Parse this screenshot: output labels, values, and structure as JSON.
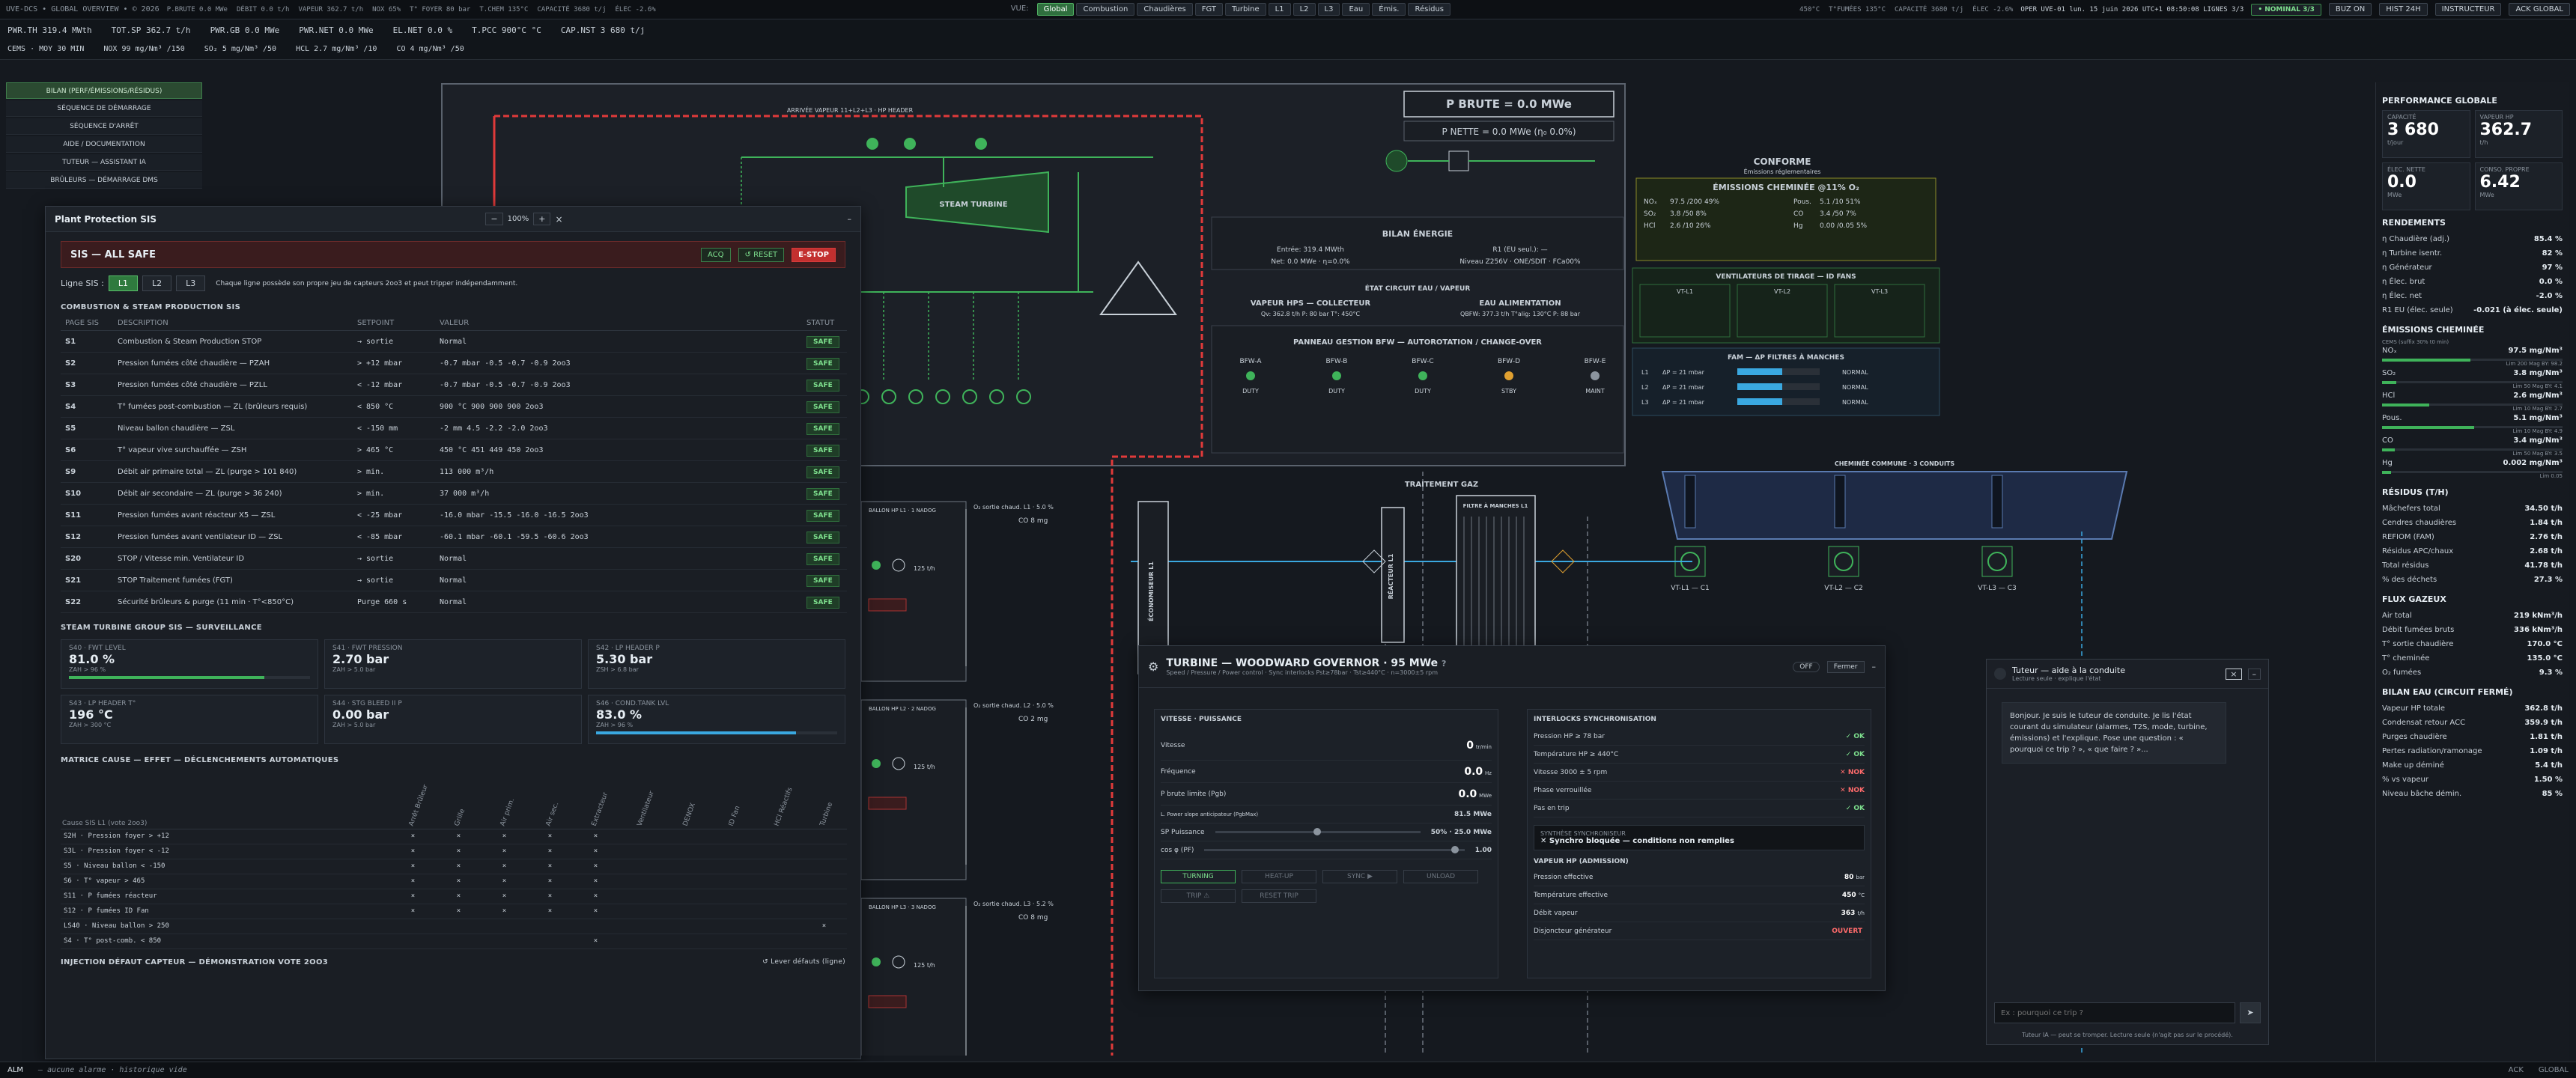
{
  "topbar": {
    "brand": "UVE-DCS • GLOBAL OVERVIEW • © 2026",
    "ticker": [
      "P.BRUTE 0.0 MWe",
      "DÉBIT 0.0 t/h",
      "VAPEUR 362.7 t/h",
      "NOX 65%",
      "T° FOYER 80 bar",
      "T.CHEM 135°C",
      "CAPACITÉ 3680 t/j",
      "ÉLEC -2.6%"
    ],
    "views_label": "VUE:",
    "views": [
      "Global",
      "Combustion",
      "Chaudières",
      "FGT",
      "Turbine",
      "L1",
      "L2",
      "L3",
      "Eau",
      "Émis.",
      "Résidus"
    ],
    "views_sub": "Global",
    "ticker_right": [
      "450°C",
      "T°FUMÉES 135°C",
      "CAPACITÉ 3680 t/j",
      "ÉLEC -2.6%"
    ],
    "status": "OPER UVE-01  lun. 15 juin 2026  UTC+1 08:50:08  LIGNES 3/3",
    "nominal": "• NOMINAL 3/3",
    "buttons": [
      "BUZ ON",
      "HIST 24H",
      "INSTRUCTEUR",
      "ACK GLOBAL"
    ]
  },
  "row2": {
    "line1": [
      "PWR.TH 319.4 MWth",
      "TOT.SP 362.7 t/h",
      "PWR.GB 0.0 MWe",
      "PWR.NET 0.0 MWe",
      "EL.NET 0.0 %",
      "T.PCC 900°C °C",
      "CAP.NST 3 680 t/j"
    ],
    "line2": [
      "CEMS · MOY 30 MIN",
      "NOX 99 mg/Nm³ /150",
      "SO₂ 5 mg/Nm³ /50",
      "HCL 2.7 mg/Nm³ /10",
      "CO 4 mg/Nm³ /50"
    ]
  },
  "nav": [
    "BILAN (PERF/ÉMISSIONS/RÉSIDUS)",
    "SÉQUENCE DE DÉMARRAGE",
    "SÉQUENCE D'ARRÊT",
    "AIDE / DOCUMENTATION",
    "TUTEUR — ASSISTANT IA",
    "BRÛLEURS — DÉMARRAGE DMS"
  ],
  "diagram": {
    "title_header": "ARRIVÉE VAPEUR 11+L2+L3 · HP HEADER",
    "p_brute": "P BRUTE = 0.0 MWe",
    "p_nette": "P NETTE = 0.0 MWe (η₀ 0.0%)",
    "steam_turbine": "STEAM TURBINE",
    "conforme": "CONFORME",
    "conforme_sub": "Émissions réglementaires",
    "emissions_title": "ÉMISSIONS CHEMINÉE @11% O₂",
    "emissions": [
      {
        "k": "NOₓ",
        "v": "97.5 /200 49%"
      },
      {
        "k": "SO₂",
        "v": "3.8 /50 8%"
      },
      {
        "k": "HCl",
        "v": "2.6 /10 26%"
      },
      {
        "k": "Pous.",
        "v": "5.1 /10 51%"
      },
      {
        "k": "CO",
        "v": "3.4 /50 7%"
      },
      {
        "k": "Hg",
        "v": "0.00 /0.05 5%"
      }
    ],
    "bilan_title": "BILAN ÉNERGIE",
    "bilan_lines": [
      "Entrée: 319.4 MWth",
      "Net: 0.0 MWe · η=0.0%",
      "R1 (EU seul.): —",
      "Niveau Z256V · ONE/SDIT · FCa00%"
    ],
    "etat_title": "ÉTAT CIRCUIT EAU / VAPEUR",
    "vapeur_title": "VAPEUR HPS — COLLECTEUR",
    "vapeur_line": "Qv: 362.8 t/h P: 80 bar T°: 450°C",
    "eau_title": "EAU ALIMENTATION",
    "eau_line": "QBFW: 377.3 t/h T°alig: 130°C P: 88 bar",
    "panneau": "PANNEAU GESTION BFW — AUTOROTATION / CHANGE-OVER",
    "pumps": [
      {
        "n": "BFW-A",
        "s": "DUTY",
        "c": "#3fb35a"
      },
      {
        "n": "BFW-B",
        "s": "DUTY",
        "c": "#3fb35a"
      },
      {
        "n": "BFW-C",
        "s": "DUTY",
        "c": "#3fb35a"
      },
      {
        "n": "BFW-D",
        "s": "STBY",
        "c": "#e0a030"
      },
      {
        "n": "BFW-E",
        "s": "MAINT",
        "c": "#8b949e"
      }
    ],
    "ventilateurs": "VENTILATEURS DE TIRAGE — ID FANS",
    "vt": [
      "VT-L1",
      "VT-L2",
      "VT-L3"
    ],
    "fam": "FAM — ΔP FILTRES À MANCHES",
    "fam_rows": [
      {
        "l": "L1",
        "v": "ΔP = 21 mbar",
        "s": "NORMAL"
      },
      {
        "l": "L2",
        "v": "ΔP = 21 mbar",
        "s": "NORMAL"
      },
      {
        "l": "L3",
        "v": "ΔP = 21 mbar",
        "s": "NORMAL"
      }
    ],
    "cheminee": "CHEMINÉE COMMUNE · 3 CONDUITS",
    "vt_bottom": [
      "VT-L1 — C1",
      "VT-L2 — C2",
      "VT-L3 — C3"
    ],
    "traitement": "TRAITEMENT GAZ",
    "filtre": "FILTRE À MANCHES L1",
    "economiseur": "ÉCONOMISEUR L1",
    "reacteur": "RÉACTEUR L1",
    "ballons": [
      "BALLON HP L1 · 1 NADOG",
      "BALLON HP L2 · 2 NADOG",
      "BALLON HP L3 · 3 NADOG"
    ],
    "o2": [
      "O₂ sortie chaud. L1 · 5.0 %",
      "O₂ sortie chaud. L2 · 5.0 %",
      "O₂ sortie chaud. L3 · 5.2 %"
    ],
    "co": [
      "CO 8 mg",
      "CO 2 mg",
      "CO 8 mg"
    ],
    "flow": [
      "125 t/h",
      "125 t/h",
      "125 t/h"
    ]
  },
  "sis": {
    "title": "Plant Protection SIS",
    "zoom": "100%",
    "status": "SIS — ALL SAFE",
    "ack": "ACQ",
    "reset": "↺ RESET",
    "estop": "E-STOP",
    "lines_label": "Ligne SIS :",
    "lines": [
      "L1",
      "L2",
      "L3"
    ],
    "lines_note": "Chaque ligne possède son propre jeu de capteurs 2oo3 et peut tripper indépendamment.",
    "sect1": "COMBUSTION & STEAM PRODUCTION SIS",
    "cols": [
      "PAGE SIS",
      "DESCRIPTION",
      "SETPOINT",
      "VALEUR",
      "STATUT"
    ],
    "rows": [
      {
        "p": "S1",
        "d": "Combustion & Steam Production STOP",
        "sp": "→ sortie",
        "v": "Normal",
        "s": "SAFE"
      },
      {
        "p": "S2",
        "d": "Pression fumées côté chaudière — PZAH",
        "sp": "> +12 mbar",
        "v": "-0.7 mbar  -0.5 -0.7 -0.9  2oo3",
        "s": "SAFE"
      },
      {
        "p": "S3",
        "d": "Pression fumées côté chaudière — PZLL",
        "sp": "< -12 mbar",
        "v": "-0.7 mbar  -0.5 -0.7 -0.9  2oo3",
        "s": "SAFE"
      },
      {
        "p": "S4",
        "d": "T° fumées post-combustion — ZL (brûleurs requis)",
        "sp": "< 850 °C",
        "v": "900 °C  900 900 900  2oo3",
        "s": "SAFE"
      },
      {
        "p": "S5",
        "d": "Niveau ballon chaudière — ZSL",
        "sp": "< -150 mm",
        "v": "-2 mm  4.5 -2.2 -2.0  2oo3",
        "s": "SAFE"
      },
      {
        "p": "S6",
        "d": "T° vapeur vive surchauffée — ZSH",
        "sp": "> 465 °C",
        "v": "450 °C  451 449 450  2oo3",
        "s": "SAFE"
      },
      {
        "p": "S9",
        "d": "Débit air primaire total — ZL (purge > 101 840)",
        "sp": "> min.",
        "v": "113 000 m³/h",
        "s": "SAFE"
      },
      {
        "p": "S10",
        "d": "Débit air secondaire — ZL (purge > 36 240)",
        "sp": "> min.",
        "v": "37 000 m³/h",
        "s": "SAFE"
      },
      {
        "p": "S11",
        "d": "Pression fumées avant réacteur X5 — ZSL",
        "sp": "< -25 mbar",
        "v": "-16.0 mbar  -15.5 -16.0 -16.5  2oo3",
        "s": "SAFE"
      },
      {
        "p": "S12",
        "d": "Pression fumées avant ventilateur ID — ZSL",
        "sp": "< -85 mbar",
        "v": "-60.1 mbar  -60.1 -59.5 -60.6  2oo3",
        "s": "SAFE"
      },
      {
        "p": "S20",
        "d": "STOP / Vitesse min. Ventilateur ID",
        "sp": "→ sortie",
        "v": "Normal",
        "s": "SAFE"
      },
      {
        "p": "S21",
        "d": "STOP Traitement fumées (FGT)",
        "sp": "→ sortie",
        "v": "Normal",
        "s": "SAFE"
      },
      {
        "p": "S22",
        "d": "Sécurité brûleurs & purge (11 min · T°<850°C)",
        "sp": "Purge 660 s",
        "v": "Normal",
        "s": "SAFE"
      }
    ],
    "sect2": "STEAM TURBINE GROUP SIS — SURVEILLANCE",
    "cards": [
      {
        "k": "S40 · FWT LEVEL",
        "v": "81.0 %",
        "sub": "ZAH > 96 %",
        "pct": 81,
        "c": ""
      },
      {
        "k": "S41 · FWT PRESSION",
        "v": "2.70 bar",
        "sub": "ZAH > 5.0 bar",
        "pct": 0,
        "c": ""
      },
      {
        "k": "S42 · LP HEADER P",
        "v": "5.30 bar",
        "sub": "ZSH > 6.8 bar",
        "pct": 0,
        "c": ""
      },
      {
        "k": "S43 · LP HEADER T°",
        "v": "196 °C",
        "sub": "ZAH > 300 °C",
        "pct": 0,
        "c": ""
      },
      {
        "k": "S44 · STG BLEED II P",
        "v": "0.00 bar",
        "sub": "ZAH > 5.0 bar",
        "pct": 0,
        "c": ""
      },
      {
        "k": "S46 · COND.TANK LVL",
        "v": "83.0 %",
        "sub": "ZAH > 96 %",
        "pct": 83,
        "c": "b"
      }
    ],
    "sect3": "MATRICE CAUSE — EFFET — DÉCLENCHEMENTS AUTOMATIQUES",
    "mat_head": "Cause SIS L1 (vote 2oo3)",
    "mat_cols": [
      "Arrêt Brûleur",
      "Grille",
      "Air prim.",
      "Air sec.",
      "Extracteur",
      "Ventilateur",
      "DENOX",
      "ID Fan",
      "HCl Réactifs",
      "Turbine"
    ],
    "mat_rows": [
      {
        "c": "S2H · Pression foyer > +12",
        "x": [
          1,
          1,
          1,
          1,
          1,
          0,
          0,
          0,
          0,
          0
        ]
      },
      {
        "c": "S3L · Pression foyer < -12",
        "x": [
          1,
          1,
          1,
          1,
          1,
          0,
          0,
          0,
          0,
          0
        ]
      },
      {
        "c": "S5 · Niveau ballon < -150",
        "x": [
          1,
          1,
          1,
          1,
          1,
          0,
          0,
          0,
          0,
          0
        ]
      },
      {
        "c": "S6 · T° vapeur > 465",
        "x": [
          1,
          1,
          1,
          1,
          1,
          0,
          0,
          0,
          0,
          0
        ]
      },
      {
        "c": "S11 · P fumées réacteur",
        "x": [
          1,
          1,
          1,
          1,
          1,
          0,
          0,
          0,
          0,
          0
        ]
      },
      {
        "c": "S12 · P fumées ID Fan",
        "x": [
          1,
          1,
          1,
          1,
          1,
          0,
          0,
          0,
          0,
          0
        ]
      },
      {
        "c": "LS40 · Niveau ballon > 250",
        "x": [
          0,
          0,
          0,
          0,
          0,
          0,
          0,
          0,
          0,
          1
        ]
      },
      {
        "c": "S4 · T° post-comb. < 850",
        "x": [
          0,
          0,
          0,
          0,
          1,
          0,
          0,
          0,
          0,
          0
        ]
      }
    ],
    "sect4": "INJECTION DÉFAUT CAPTEUR — DÉMONSTRATION VOTE 2OO3",
    "inj_link": "↺ Lever défauts (ligne)"
  },
  "turbine": {
    "title": "TURBINE — WOODWARD GOVERNOR · 95 MWe",
    "subtitle": "Speed / Pressure / Power control · Sync interlocks Pst≥78bar · Tst≥440°C · n=3000±5 rpm",
    "off": "OFF",
    "close": "Fermer",
    "left_title": "VITESSE · PUISSANCE",
    "vitesse_k": "Vitesse",
    "vitesse_v": "0",
    "vitesse_u": "tr/min",
    "freq_k": "Fréquence",
    "freq_v": "0.0",
    "freq_u": "Hz",
    "pb_k": "P brute limite (Pgb)",
    "pb_v": "0.0",
    "pb_u": "MWe",
    "lim_k": "L. Power slope anticipateur (PgbMax)",
    "lim_v": "81.5 MWe",
    "sp_k": "SP Puissance",
    "sp_v": "50% · 25.0 MWe",
    "cos_k": "cos φ (PF)",
    "cos_v": "1.00",
    "modes": [
      "TURNING",
      "HEAT-UP",
      "SYNC ▶",
      "UNLOAD",
      "TRIP ⚠",
      "RESET TRIP"
    ],
    "right_title": "INTERLOCKS SYNCHRONISATION",
    "interlocks": [
      {
        "k": "Pression HP ≥ 78 bar",
        "s": "✓ OK",
        "ok": true
      },
      {
        "k": "Température HP ≥ 440°C",
        "s": "✓ OK",
        "ok": true
      },
      {
        "k": "Vitesse 3000 ± 5 rpm",
        "s": "✕ NOK",
        "ok": false
      },
      {
        "k": "Phase verrouillée",
        "s": "✕ NOK",
        "ok": false
      },
      {
        "k": "Pas en trip",
        "s": "✓ OK",
        "ok": true
      }
    ],
    "synth_k": "SYNTHÈSE SYNCHRONISEUR",
    "synth_v": "✕ Synchro bloquée — conditions non remplies",
    "admission_title": "VAPEUR HP (ADMISSION)",
    "admission": [
      {
        "k": "Pression effective",
        "v": "80",
        "u": "bar"
      },
      {
        "k": "Température effective",
        "v": "450",
        "u": "°C"
      },
      {
        "k": "Débit vapeur",
        "v": "363",
        "u": "t/h"
      },
      {
        "k": "Disjoncteur générateur",
        "v": "OUVERT",
        "u": ""
      }
    ]
  },
  "tutor": {
    "title": "Tuteur — aide à la conduite",
    "sub": "Lecture seule · explique l'état",
    "message": "Bonjour. Je suis le tuteur de conduite. Je lis l'état courant du simulateur (alarmes, T2S, mode, turbine, émissions) et l'explique. Pose une question : « pourquoi ce trip ? », « que faire ? »...",
    "placeholder": "Ex : pourquoi ce trip ?",
    "footer": "Tuteur IA — peut se tromper. Lecture seule (n'agit pas sur le procédé)."
  },
  "right": {
    "perf_title": "PERFORMANCE GLOBALE",
    "kpis": [
      {
        "k": "CAPACITÉ",
        "v": "3 680",
        "u": "t/jour"
      },
      {
        "k": "VAPEUR HP",
        "v": "362.7",
        "u": "t/h"
      },
      {
        "k": "ÉLEC. NETTE",
        "v": "0.0",
        "u": "MWe"
      },
      {
        "k": "CONSO. PROPRE",
        "v": "6.42",
        "u": "MWe"
      }
    ],
    "rend_title": "RENDEMENTS",
    "rend": [
      {
        "k": "η Chaudière (adj.)",
        "v": "85.4 %"
      },
      {
        "k": "η Turbine isentr.",
        "v": "82 %"
      },
      {
        "k": "η Générateur",
        "v": "97 %"
      },
      {
        "k": "η Élec. brut",
        "v": "0.0 %"
      },
      {
        "k": "η Élec. net",
        "v": "-2.0 %"
      },
      {
        "k": "R1 EU (élec. seule)",
        "v": "-0.021 (à élec. seule)"
      }
    ],
    "emi_title": "ÉMISSIONS CHEMINÉE",
    "emi_note": "CEMS (suffix 30% t0 min)",
    "emi": [
      {
        "k": "NOₓ",
        "v": "97.5 mg/Nm³",
        "lim": "Lim 200 Mag BY: 98.2",
        "pct": 49
      },
      {
        "k": "SO₂",
        "v": "3.8 mg/Nm³",
        "lim": "Lim 50 Mag BY: 4.1",
        "pct": 8
      },
      {
        "k": "HCl",
        "v": "2.6 mg/Nm³",
        "lim": "Lim 10 Mag BY: 2.7",
        "pct": 26
      },
      {
        "k": "Pous.",
        "v": "5.1 mg/Nm³",
        "lim": "Lim 10 Mag BY: 4.9",
        "pct": 51
      },
      {
        "k": "CO",
        "v": "3.4 mg/Nm³",
        "lim": "Lim 50 Mag BY: 3.5",
        "pct": 7
      },
      {
        "k": "Hg",
        "v": "0.002 mg/Nm³",
        "lim": "Lim 0.05",
        "pct": 5
      }
    ],
    "res_title": "RÉSIDUS (T/H)",
    "res": [
      {
        "k": "Mâchefers total",
        "v": "34.50 t/h"
      },
      {
        "k": "Cendres chaudières",
        "v": "1.84 t/h"
      },
      {
        "k": "REFIOM (FAM)",
        "v": "2.76 t/h"
      },
      {
        "k": "Résidus APC/chaux",
        "v": "2.68 t/h"
      },
      {
        "k": "Total résidus",
        "v": "41.78 t/h"
      },
      {
        "k": "% des déchets",
        "v": "27.3 %"
      }
    ],
    "flux_title": "FLUX GAZEUX",
    "flux": [
      {
        "k": "Air total",
        "v": "219 kNm³/h"
      },
      {
        "k": "Débit fumées bruts",
        "v": "336 kNm³/h"
      },
      {
        "k": "T° sortie chaudière",
        "v": "170.0 °C"
      },
      {
        "k": "T° cheminée",
        "v": "135.0 °C"
      },
      {
        "k": "O₂ fumées",
        "v": "9.3 %"
      }
    ],
    "eau_title": "BILAN EAU (CIRCUIT FERMÉ)",
    "eau": [
      {
        "k": "Vapeur HP totale",
        "v": "362.8 t/h"
      },
      {
        "k": "Condensat retour ACC",
        "v": "359.9 t/h"
      },
      {
        "k": "Purges chaudière",
        "v": "1.81 t/h"
      },
      {
        "k": "Pertes radiation/ramonage",
        "v": "1.09 t/h"
      },
      {
        "k": "Make up déminé",
        "v": "5.4 t/h"
      },
      {
        "k": "% vs vapeur",
        "v": "1.50 %"
      },
      {
        "k": "Niveau bâche démin.",
        "v": "85 %"
      }
    ]
  },
  "footer": {
    "alm": "ALM",
    "text": "— aucune alarme · historique vide",
    "ack": "ACK",
    "global": "GLOBAL"
  }
}
